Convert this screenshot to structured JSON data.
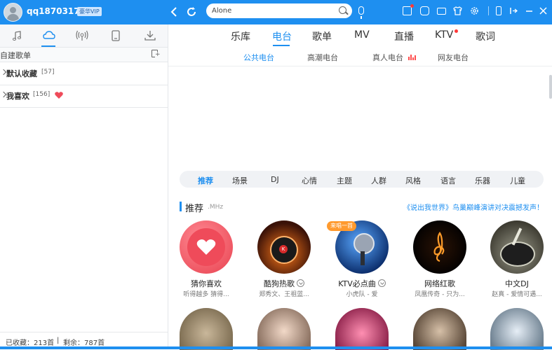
{
  "titlebar": {
    "username": "qq1870317...",
    "vip_label": "豪华VIP",
    "search_value": "Alone",
    "search_placeholder": ""
  },
  "left": {
    "tabs": [
      "music-note-icon",
      "cloud-icon",
      "radio-broadcast-icon",
      "phone-device-icon",
      "download-icon"
    ],
    "header": "自建歌单",
    "playlists": [
      {
        "name": "默认收藏",
        "count": "[57]"
      },
      {
        "name": "我喜欢",
        "count": "[156]"
      }
    ],
    "status": {
      "collected": "已收藏：213首",
      "sep": "|",
      "remaining": "剩余：787首"
    }
  },
  "main": {
    "tabs": [
      "乐库",
      "电台",
      "歌单",
      "MV",
      "直播",
      "KTV",
      "歌词"
    ],
    "subtabs": [
      "公共电台",
      "高潮电台",
      "真人电台",
      "网友电台"
    ],
    "categories": [
      "推荐",
      "场景",
      "DJ",
      "心情",
      "主题",
      "人群",
      "风格",
      "语言",
      "乐器",
      "儿童"
    ],
    "section_title": "推荐",
    "section_sub": ".MHz",
    "ad_text": "《说出我世界》鸟巢巅峰演讲对决震撼发声！",
    "cards": [
      {
        "title": "猜你喜欢",
        "sub": "听得越多 猜得..."
      },
      {
        "title": "酷狗热歌",
        "sub": "郑秀文、王祖蓝..."
      },
      {
        "title": "KTV必点曲",
        "sub": "小虎队 - 爱",
        "badge": "来唱一首"
      },
      {
        "title": "网络红歌",
        "sub": "凤凰传奇 - 只为..."
      },
      {
        "title": "中文DJ",
        "sub": "赵真 - 爱情可遇..."
      }
    ]
  },
  "colors": {
    "accent": "#1e8ff0",
    "heart": "#ef4b5a",
    "badge": "#ff9a2e"
  }
}
